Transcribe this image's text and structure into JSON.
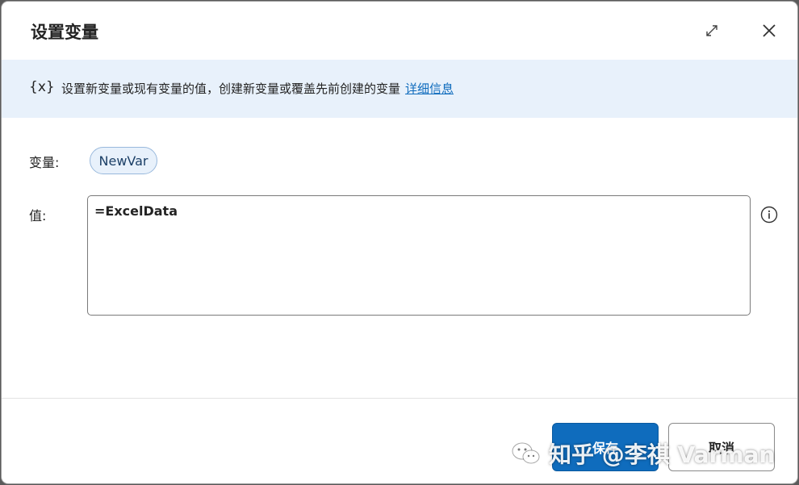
{
  "dialog": {
    "title": "设置变量",
    "expand_icon": "expand-icon",
    "close_icon": "close-icon"
  },
  "banner": {
    "glyph": "{x}",
    "text": "设置新变量或现有变量的值，创建新变量或覆盖先前创建的变量",
    "link": "详细信息"
  },
  "form": {
    "variable_label": "变量:",
    "variable_name": "NewVar",
    "value_label": "值:",
    "value_text": "=ExcelData",
    "help_icon": "info-icon"
  },
  "footer": {
    "save_label": "保存",
    "cancel_label": "取消"
  },
  "watermark": {
    "text": "知乎 @李祺 Varman",
    "logo": "wechat-logo"
  },
  "colors": {
    "accent": "#0f6cbd",
    "banner_bg": "#e8f1fb",
    "chip_bg": "#e8f1fb"
  }
}
